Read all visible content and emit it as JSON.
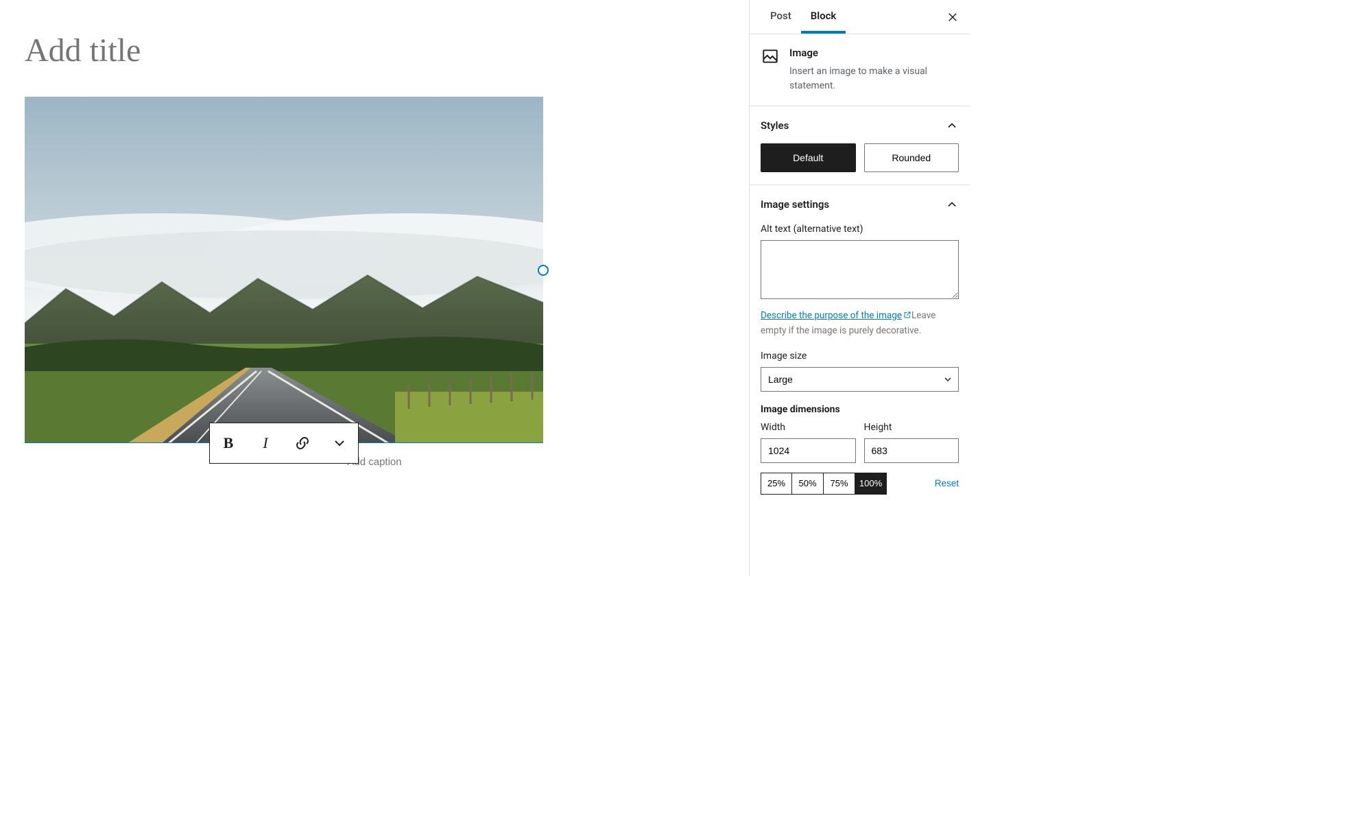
{
  "editor": {
    "title_placeholder": "Add title",
    "caption_placeholder": "Add caption"
  },
  "format_toolbar": {
    "bold_label": "B",
    "italic_label": "I"
  },
  "sidebar": {
    "tabs": {
      "post": "Post",
      "block": "Block",
      "active": "block"
    },
    "block_card": {
      "title": "Image",
      "description": "Insert an image to make a visual statement."
    },
    "styles": {
      "heading": "Styles",
      "default": "Default",
      "rounded": "Rounded",
      "active": "default"
    },
    "image_settings": {
      "heading": "Image settings",
      "alt_label": "Alt text (alternative text)",
      "alt_value": "",
      "help_link": "Describe the purpose of the image",
      "help_text": "Leave empty if the image is purely decorative.",
      "size_label": "Image size",
      "size_value": "Large",
      "dimensions_heading": "Image dimensions",
      "width_label": "Width",
      "width_value": "1024",
      "height_label": "Height",
      "height_value": "683",
      "pct_25": "25%",
      "pct_50": "50%",
      "pct_75": "75%",
      "pct_100": "100%",
      "pct_active": "100",
      "reset": "Reset"
    }
  }
}
